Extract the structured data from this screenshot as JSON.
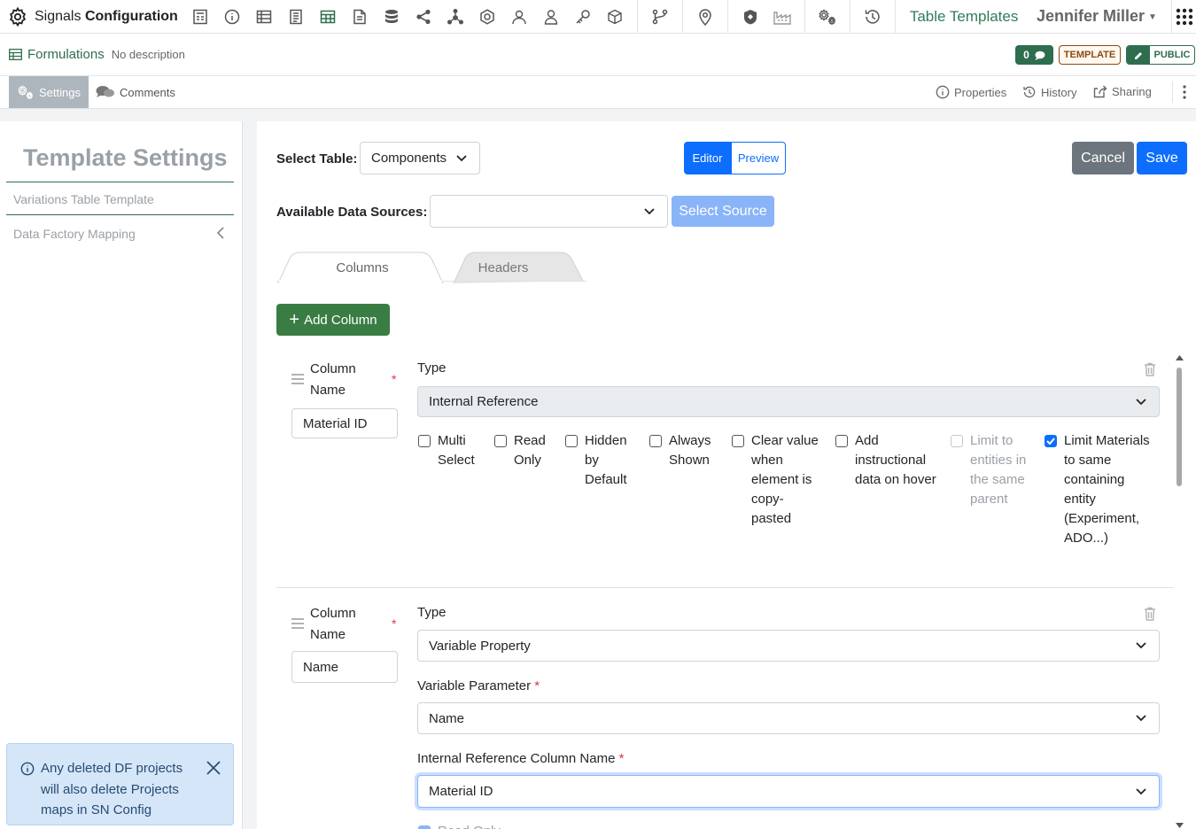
{
  "topbar": {
    "brand_prefix": "Signals",
    "brand_suffix": "Configuration",
    "icons": [
      "form-icon",
      "info-icon",
      "table-icon",
      "document-icon",
      "grid-icon",
      "file-icon",
      "database-icon",
      "share-icon",
      "network-icon",
      "hexagon-icon",
      "group-icon",
      "person-icon",
      "key-icon",
      "cube-icon",
      "branch-icon",
      "map-pin-icon",
      "shield-icon",
      "factory-icon",
      "settings-gears-icon",
      "history-icon"
    ],
    "active_link": "Table Templates",
    "user_name": "Jennifer Miller"
  },
  "formbar": {
    "title": "Formulations",
    "description": "No description",
    "comment_count": "0",
    "badge_template": "TEMPLATE",
    "badge_public": "PUBLIC"
  },
  "tabbar": {
    "settings": "Settings",
    "comments": "Comments",
    "properties": "Properties",
    "history": "History",
    "sharing": "Sharing"
  },
  "sidebar": {
    "title": "Template Settings",
    "items": [
      {
        "label": "Variations Table Template"
      },
      {
        "label": "Data Factory Mapping"
      }
    ],
    "info_message": "Any deleted DF projects will also delete Projects maps in SN Config"
  },
  "main": {
    "select_table_label": "Select Table:",
    "select_table_value": "Components",
    "editor_label": "Editor",
    "preview_label": "Preview",
    "cancel_label": "Cancel",
    "save_label": "Save",
    "data_sources_label": "Available Data Sources:",
    "data_sources_value": "",
    "select_source_label": "Select Source",
    "tabs": [
      {
        "label": "Columns"
      },
      {
        "label": "Headers"
      }
    ],
    "add_column_label": "Add Column",
    "columns": [
      {
        "name_label": "Column Name",
        "name_value": "Material ID",
        "type_label": "Type",
        "type_value": "Internal Reference",
        "checkboxes": [
          {
            "label": "Multi Select",
            "checked": false
          },
          {
            "label": "Read Only",
            "checked": false
          },
          {
            "label": "Hidden by Default",
            "checked": false
          },
          {
            "label": "Always Shown",
            "checked": false
          },
          {
            "label": "Clear value when element is copy-pasted",
            "checked": false
          },
          {
            "label": "Add instructional data on hover",
            "checked": false
          },
          {
            "label": "Limit to entities in the same parent",
            "checked": false,
            "disabled": true
          },
          {
            "label": "Limit Materials to same containing entity (Experiment, ADO...)",
            "checked": true
          }
        ]
      },
      {
        "name_label": "Column Name",
        "name_value": "Name",
        "type_label": "Type",
        "type_value": "Variable Property",
        "variable_parameter_label": "Variable Parameter",
        "variable_parameter_value": "Name",
        "internal_ref_label": "Internal Reference Column Name",
        "internal_ref_value": "Material ID",
        "partial_checkbox_label": "Read Only"
      }
    ]
  },
  "colors": {
    "primary": "#0d6efd",
    "success": "#3a7d44",
    "brand_green": "#2e6d4e",
    "info_bg": "#d5e6f8"
  }
}
